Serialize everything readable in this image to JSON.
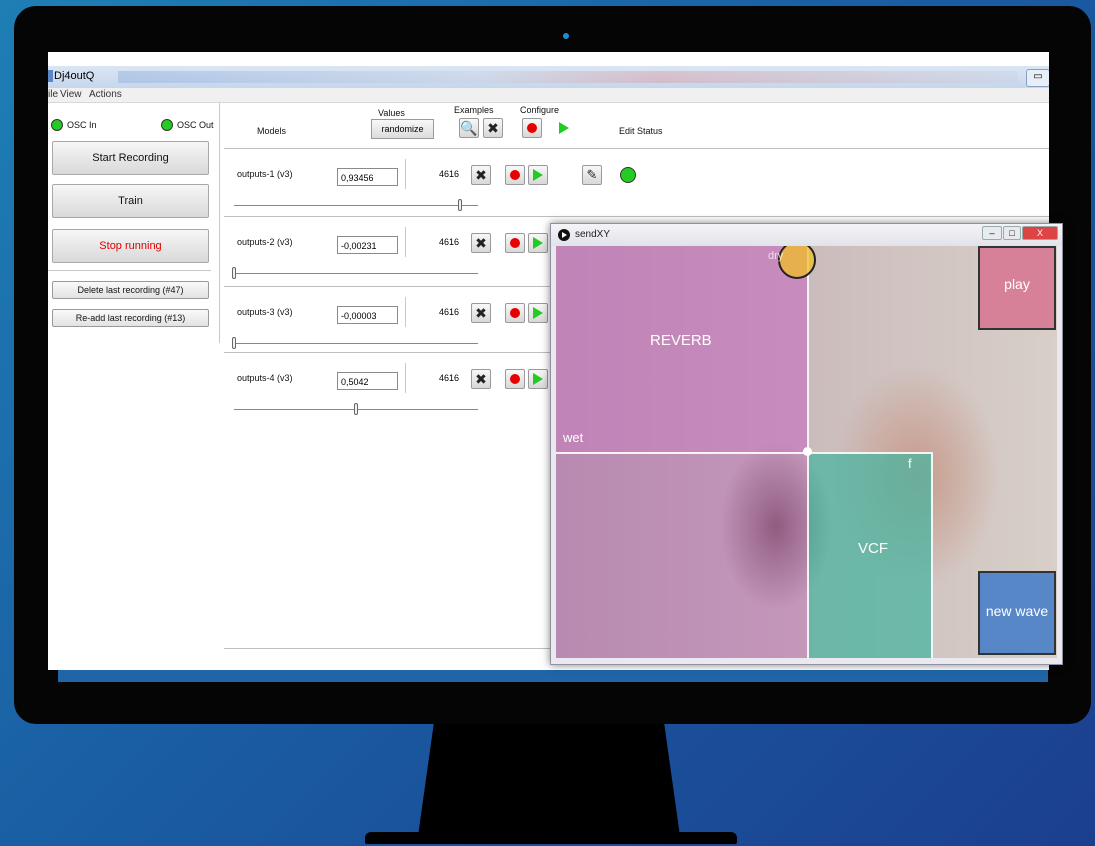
{
  "window": {
    "title": "Dj4outQ",
    "minimize_glyph": "▭"
  },
  "menubar": {
    "items": [
      "ile",
      "View",
      "Actions"
    ]
  },
  "osc": {
    "in_label": "OSC In",
    "out_label": "OSC Out",
    "led_color": "#22cc22"
  },
  "left_buttons": {
    "start_recording": "Start Recording",
    "train": "Train",
    "stop_running": "Stop running",
    "delete_last": "Delete last recording (#47)",
    "readd_last": "Re-add last recording (#13)"
  },
  "header": {
    "models": "Models",
    "values": "Values",
    "randomize": "randomize",
    "examples": "Examples",
    "configure": "Configure",
    "edit_status": "Edit Status"
  },
  "models": [
    {
      "name": "outputs-1 (v3)",
      "value": "0,93456",
      "count": "4616",
      "slider_fraction": 0.93
    },
    {
      "name": "outputs-2 (v3)",
      "value": "-0,00231",
      "count": "4616",
      "slider_fraction": 0.0
    },
    {
      "name": "outputs-3 (v3)",
      "value": "-0,00003",
      "count": "4616",
      "slider_fraction": 0.0
    },
    {
      "name": "outputs-4 (v3)",
      "value": "0,5042",
      "count": "4616",
      "slider_fraction": 0.5
    }
  ],
  "sendxy": {
    "title": "sendXY",
    "controls": [
      "–",
      "□",
      "X"
    ],
    "labels": {
      "reverb": "REVERB",
      "wet": "wet",
      "vcf": "VCF",
      "f": "f",
      "play": "play",
      "new_wave": "new wave",
      "cursor": "dry"
    }
  },
  "colors": {
    "stop_text": "#e00000",
    "record": "#e60000",
    "run": "#22cc22"
  },
  "icons": {
    "examples_view": "magnifier-icon",
    "examples_delete": "x-icon",
    "edit": "pencil-icon"
  }
}
